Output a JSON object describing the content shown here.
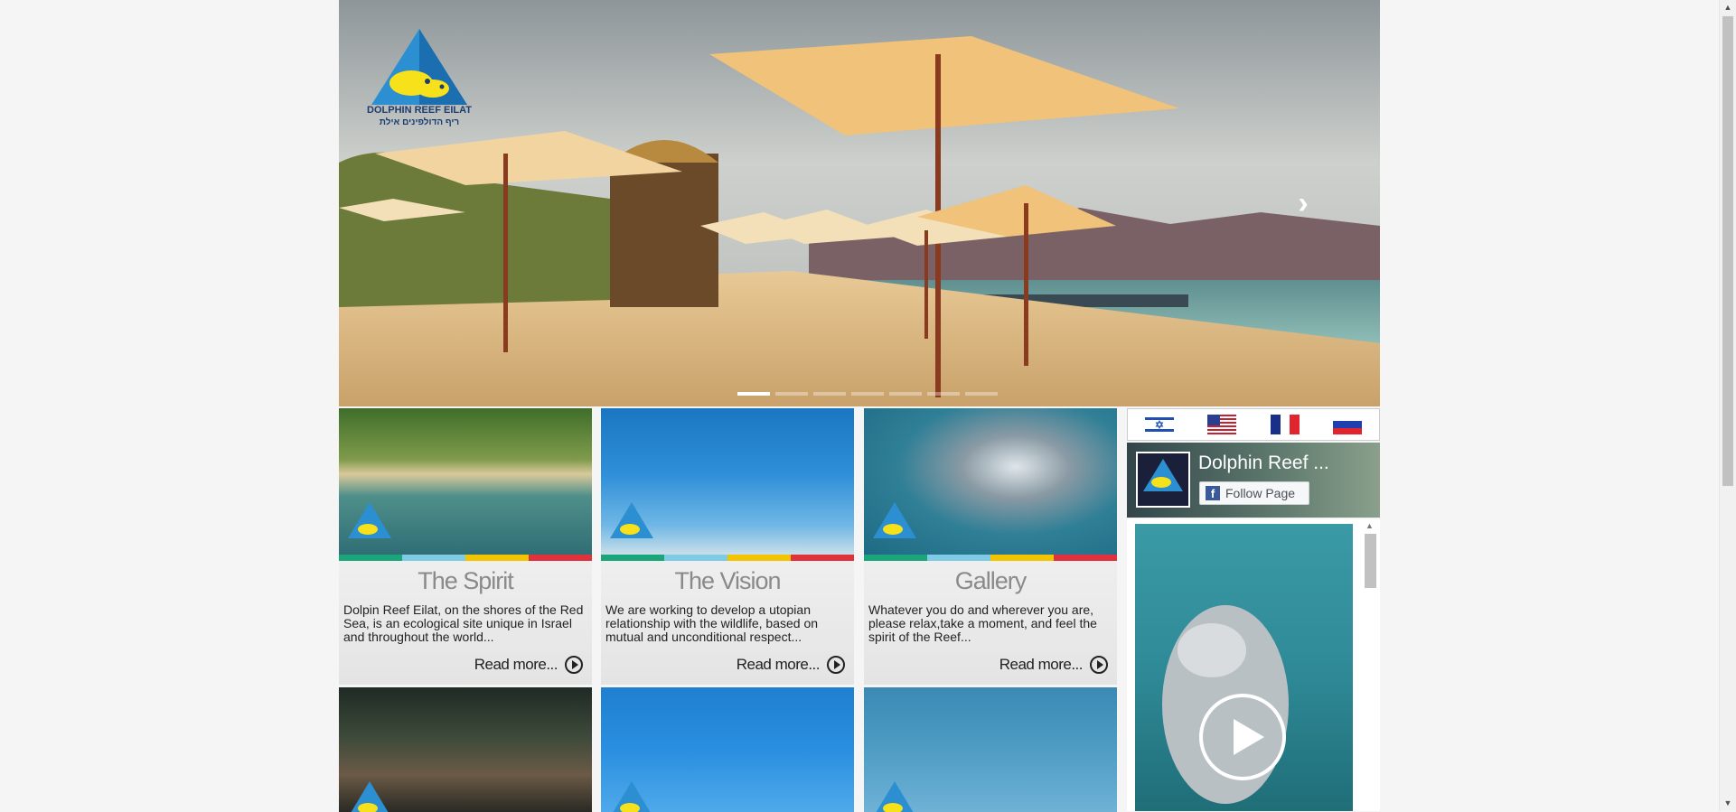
{
  "hero": {
    "logo_text": "DOLPHIN REEF EILAT",
    "logo_text_he": "ריף הדולפינים אילת",
    "slide_count": 7,
    "active_slide": 1
  },
  "cards": [
    {
      "title": "The Spirit",
      "description": "Dolpin Reef Eilat, on the shores of the Red Sea, is an ecological site unique in Israel and throughout the world...",
      "read_more": "Read more..."
    },
    {
      "title": "The Vision",
      "description": "We are working to develop a utopian relationship with the wildlife, based on mutual and unconditional respect...",
      "read_more": "Read more..."
    },
    {
      "title": "Gallery",
      "description": "Whatever you do and wherever you are, please relax,take a moment, and feel the spirit of the Reef...",
      "read_more": "Read more..."
    }
  ],
  "languages": [
    "hebrew-flag",
    "usa-flag",
    "france-flag",
    "russia-flag"
  ],
  "facebook": {
    "page_name": "Dolphin Reef ...",
    "follow_label": "Follow Page"
  },
  "colors": {
    "stripe": [
      "#1aa67a",
      "#7ecbe6",
      "#f2c500",
      "#e0323c"
    ]
  }
}
